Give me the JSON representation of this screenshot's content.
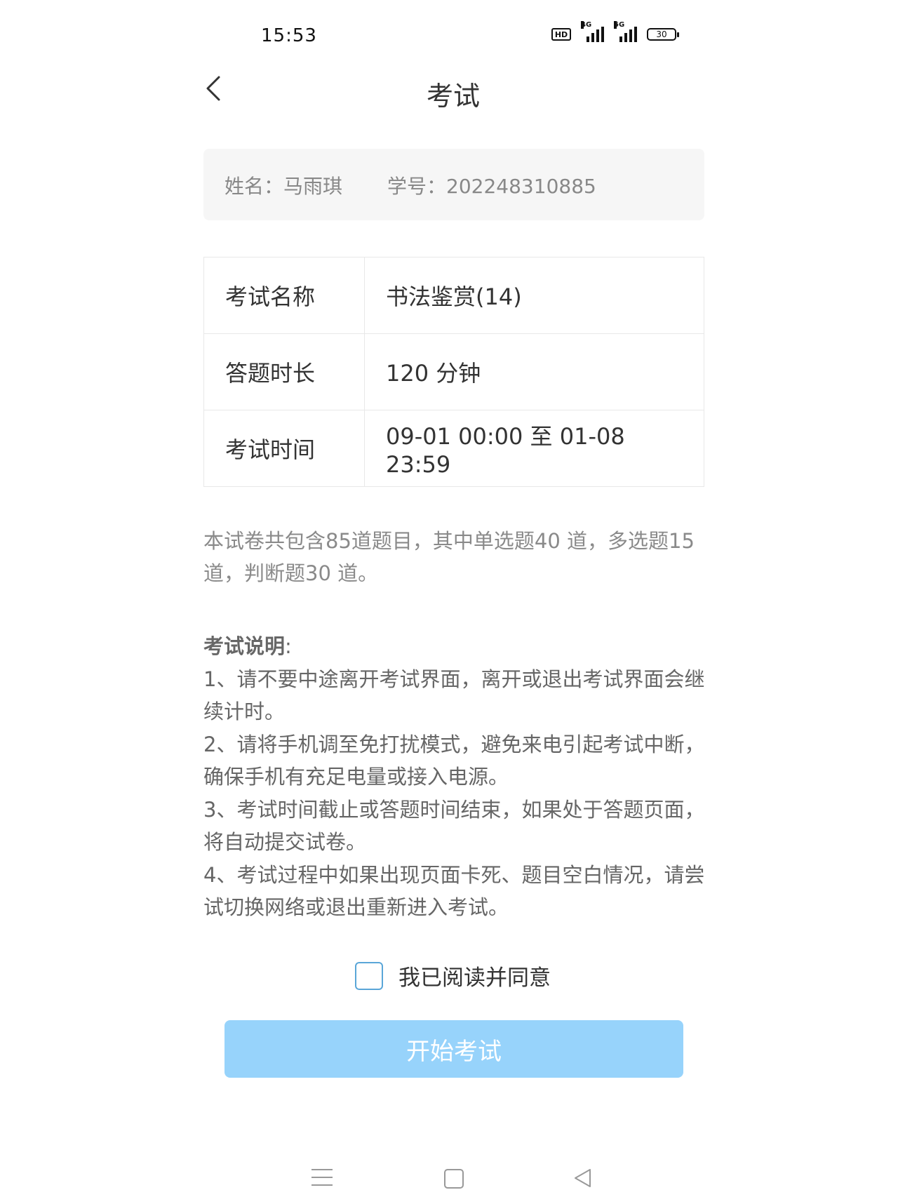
{
  "status_bar": {
    "time": "15:53",
    "network_1": "4G",
    "network_2": "5G",
    "battery": "30"
  },
  "header": {
    "title": "考试",
    "back_icon": "chevron-left-icon"
  },
  "student": {
    "name_label": "姓名：",
    "name": "马雨琪",
    "id_label": "学号：",
    "id": "202248310885"
  },
  "exam_info": [
    {
      "label": "考试名称",
      "value": "书法鉴赏(14)"
    },
    {
      "label": "答题时长",
      "value": "120 分钟"
    },
    {
      "label": "考试时间",
      "value": "09-01 00:00 至 01-08 23:59"
    }
  ],
  "summary": "本试卷共包含85道题目，其中单选题40 道，多选题15 道，判断题30 道。",
  "instructions": {
    "heading": "考试说明",
    "colon": ":",
    "items": [
      "1、请不要中途离开考试界面，离开或退出考试界面会继续计时。",
      "2、请将手机调至免打扰模式，避免来电引起考试中断，确保手机有充足电量或接入电源。",
      "3、考试时间截止或答题时间结束，如果处于答题页面，将自动提交试卷。",
      "4、考试过程中如果出现页面卡死、题目空白情况，请尝试切换网络或退出重新进入考试。"
    ]
  },
  "agreement": {
    "label": "我已阅读并同意",
    "checked": false
  },
  "start_button": "开始考试",
  "colors": {
    "button_disabled": "#97d3fb",
    "checkbox_border": "#5aa6d8"
  }
}
